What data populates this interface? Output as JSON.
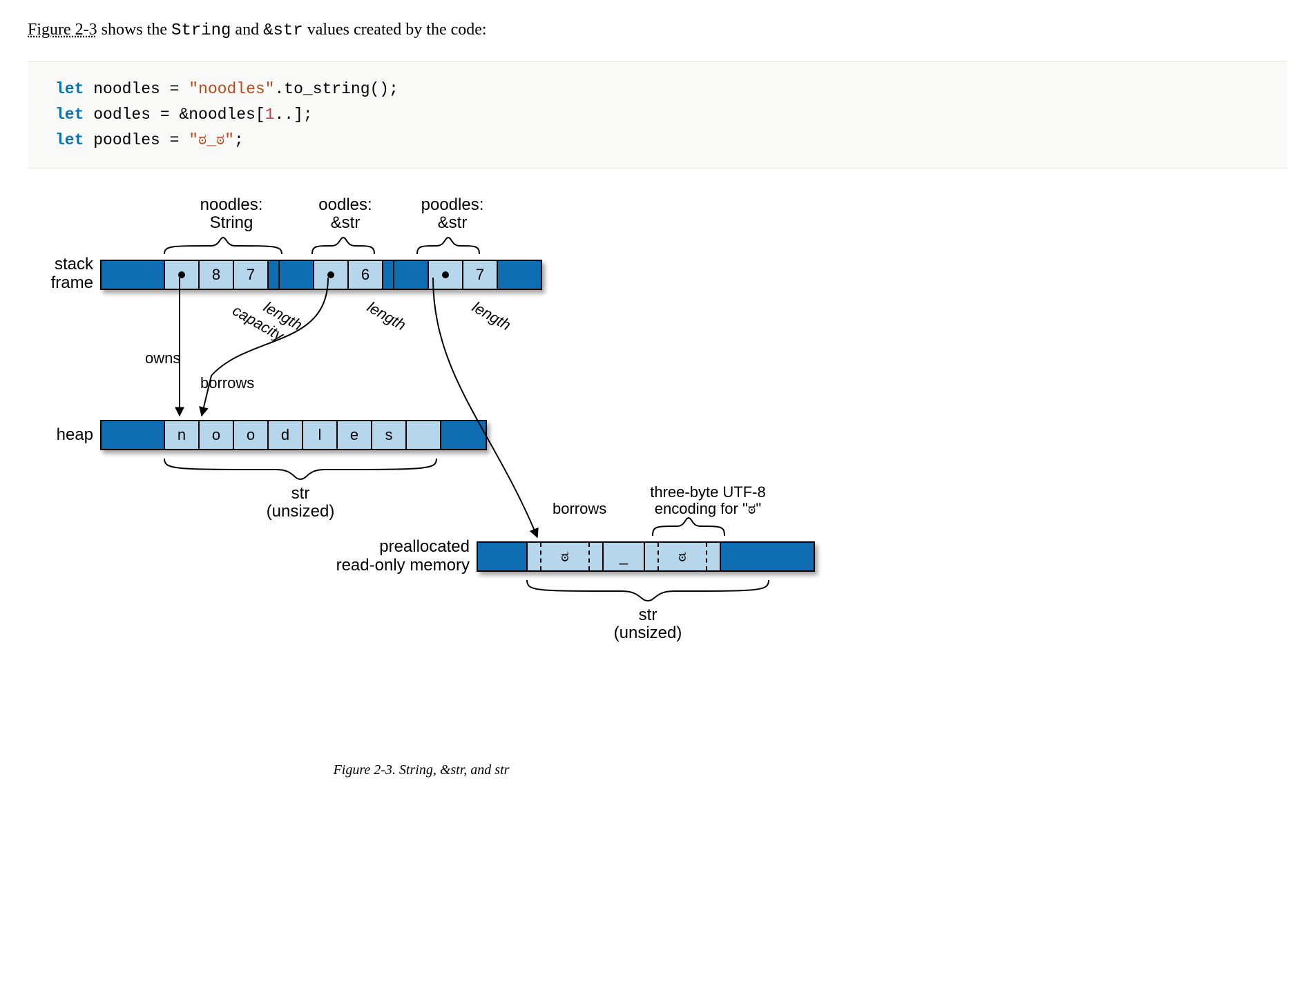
{
  "intro": {
    "figref": "Figure 2-3",
    "text_mid": " shows the ",
    "code1": "String",
    "text_and": " and ",
    "code2": "&str",
    "text_end": " values created by the code:"
  },
  "code": {
    "kw_let": "let",
    "line1_ident": " noodles = ",
    "line1_str": "\"noodles\"",
    "line1_tail": ".to_string();",
    "line2_ident": " oodles = &noodles[",
    "line2_num": "1",
    "line2_tail": "..];",
    "line3_ident": " poodles = ",
    "line3_str": "\"ಠ_ಠ\"",
    "line3_tail": ";"
  },
  "labels": {
    "stack_frame_l1": "stack",
    "stack_frame_l2": "frame",
    "heap": "heap",
    "prealloc_l1": "preallocated",
    "prealloc_l2": "read-only memory",
    "noodles_l1": "noodles:",
    "noodles_l2": "String",
    "oodles_l1": "oodles:",
    "oodles_l2": "&str",
    "poodles_l1": "poodles:",
    "poodles_l2": "&str",
    "capacity": "capacity",
    "length": "length",
    "owns": "owns",
    "borrows": "borrows",
    "str_l1": "str",
    "str_l2": "(unsized)",
    "utf8_l1": "three-byte UTF-8",
    "utf8_l2": "encoding for \"ಠ\""
  },
  "stack": {
    "noodles_capacity": "8",
    "noodles_length": "7",
    "oodles_length": "6",
    "poodles_length": "7"
  },
  "heap_bytes": [
    "n",
    "o",
    "o",
    "d",
    "l",
    "e",
    "s",
    ""
  ],
  "rom_bytes": [
    "",
    "ಠ",
    "",
    "",
    "_",
    "",
    "ಠ",
    ""
  ],
  "caption": "Figure 2-3. String, &str, and str"
}
